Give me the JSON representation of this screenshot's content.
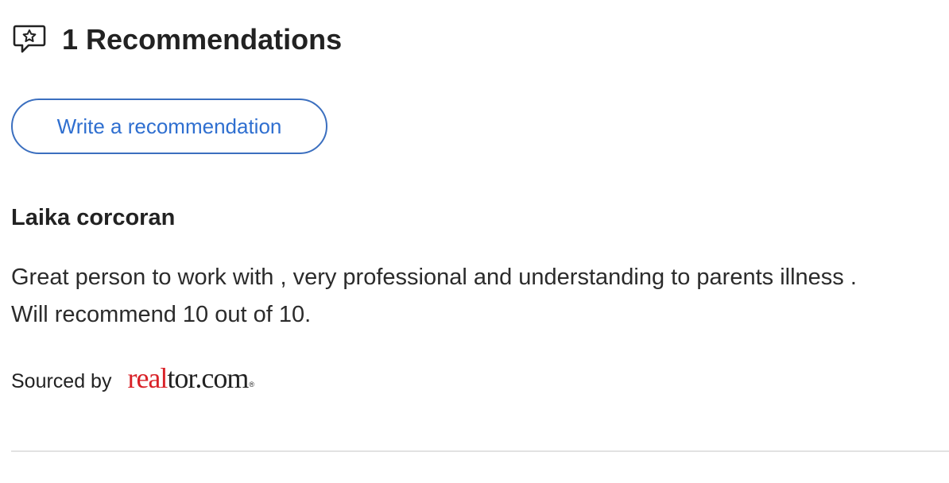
{
  "header": {
    "icon": "speech-bubble-star-icon",
    "title": "1 Recommendations"
  },
  "write_button": {
    "label": "Write a recommendation",
    "color": "#2f6fd0"
  },
  "recommendation": {
    "author": "Laika corcoran",
    "line1": "Great person to work with , very professional and understanding to parents illness .",
    "line2": "Will recommend 10 out of 10."
  },
  "source": {
    "label": "Sourced by",
    "logo_part1": "real",
    "logo_part2": "tor.com",
    "logo_mark": "®",
    "logo_accent_color": "#d92228"
  }
}
